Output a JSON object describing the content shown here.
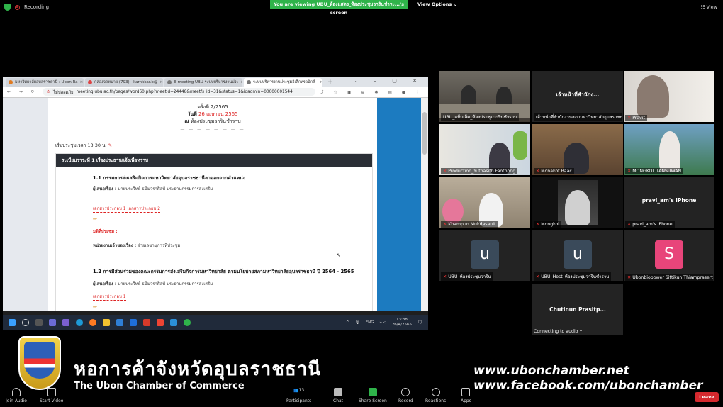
{
  "topbar": {
    "recording": "Recording",
    "viewing_banner": "You are viewing UBU_ห้องแสดง_ห้องประชุมวารินชำระ...'s screen",
    "view_options": "View Options",
    "view": "View"
  },
  "browser": {
    "tabs": [
      {
        "label": "มหาวิทยาลัยอุบลราชธานี : Ubon Ra"
      },
      {
        "label": "กล่องจดหมาย (793) - karnkkar.b@"
      },
      {
        "label": "E-meeting UBU ระบบบริหารงานประ"
      },
      {
        "label": "ระบบบริหารงานประชุมอิเล็กทรอนิกส์ -",
        "active": true
      }
    ],
    "insecure": "ไม่ปลอดภัย",
    "url": "meeting.ubu.ac.th/pages/word60.php?meetid=24448&meetfs_id=31&status=1&idadmin=00000001544"
  },
  "document": {
    "round": "ครั้งที่ 2/2565",
    "date_prefix": "วันที่",
    "date_value": "26 เมษายน 2565",
    "place_prefix": "ณ",
    "place": "ห้องประชุมวารินชำราบ",
    "dashes": "— — — — — — — —",
    "start_time": "เริ่มประชุมเวลา 13.30 น.",
    "agenda_title": "ระเบียบวาระที่ 1 เรื่องประธานแจ้งเพื่อทราบ",
    "items": [
      {
        "title": "1.1 กรรมการส่งเสริมกิจการมหาวิทยาลัยอุบลราชธานีลาออกจากตำแหน่ง",
        "proposer_label": "ผู้เสนอเรื่อง :",
        "proposer": "นายประวิทย์ ธนิมวราศิลป์ ประธานกรรมการส่งเสริม",
        "attachments": "เอกสารประกอบ 1  เอกสารประกอบ 2",
        "resolution": "มติที่ประชุม :",
        "dept_label": "หน่วยงานเจ้าของเรื่อง :",
        "dept": "ฝ่ายเลขานุการที่ประชุม"
      },
      {
        "title": "1.2 การมีส่วนร่วมของคณะกรรมการส่งเสริมกิจการมหาวิทยาลัย ตามนโยบายสภามหาวิทยาลัยอุบลราชธานี ปี 2564 - 2565",
        "proposer_label": "ผู้เสนอเรื่อง :",
        "proposer": "นายประวิทย์ ธนิมวราศิลป์ ประธานกรรมการส่งเสริม",
        "attachments": "เอกสารประกอบ 1"
      }
    ]
  },
  "taskbar": {
    "lang": "ENG",
    "time": "13:38",
    "date": "26/4/2565"
  },
  "gallery": [
    {
      "name": "UBU_แท็บเล็ต_ห้องประชุมวารินชำราบ"
    },
    {
      "name": "เจ้าหน้าที่สำนักงานสภามหาวิทยาลัยอุบลราชธานี",
      "center": "เจ้าหน้าที่สำนักง..."
    },
    {
      "name": "Pravit"
    },
    {
      "name": "Production_Yuthasith Faothong"
    },
    {
      "name": "Monakot Baac"
    },
    {
      "name": "MONGKOL TANSUWAN"
    },
    {
      "name": "Khampun Mukdasanit"
    },
    {
      "name": "Mongkol"
    },
    {
      "name": "pravi_am's iPhone",
      "center": "pravi_am's iPhone"
    },
    {
      "name": "UBU_ห้องประชุมวาริน",
      "initial": "u"
    },
    {
      "name": "UBU_Host_ห้องประชุมวารินชำราบ",
      "initial": "u"
    },
    {
      "name": "Ubonbiopower Sittikun Thiamprasert",
      "initial": "S"
    },
    {
      "center": "Chutinun Prasitp...",
      "status": "Connecting to audio ···"
    }
  ],
  "overlay": {
    "chamber_th": "หอการค้าจังหวัดอุบลราชธานี",
    "chamber_en": "The Ubon Chamber of Commerce",
    "website": "www.ubonchamber.net",
    "facebook": "www.facebook.com/ubonchamber"
  },
  "controls": {
    "join_audio": "Join Audio",
    "start_video": "Start Video",
    "participants": "Participants",
    "participants_count": "13",
    "chat": "Chat",
    "share_screen": "Share Screen",
    "record": "Record",
    "reactions": "Reactions",
    "apps": "Apps",
    "leave": "Leave"
  },
  "colors": {
    "zoom_green": "#2fb34a",
    "leave_red": "#d6292e",
    "speaker_outline": "#d6e24c",
    "avatar_u": "#3a4a5a",
    "avatar_s": "#e8457a"
  }
}
